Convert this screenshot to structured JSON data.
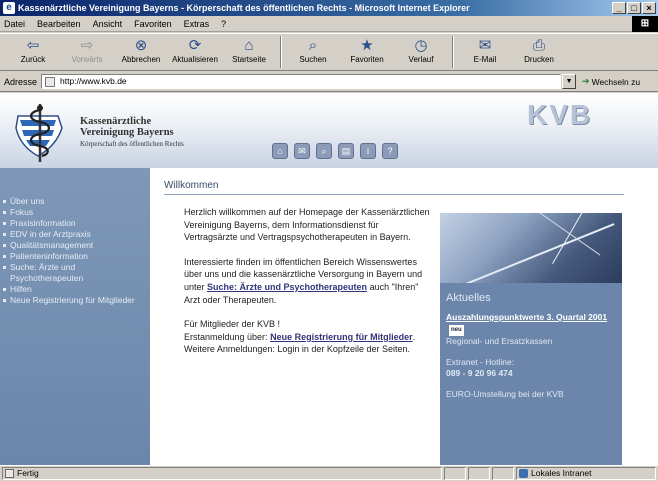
{
  "window": {
    "title": "Kassenärztliche Vereinigung Bayerns - Körperschaft des öffentlichen Rechts - Microsoft Internet Explorer",
    "controls": [
      "_",
      "□",
      "×"
    ]
  },
  "menu": {
    "items": [
      "Datei",
      "Bearbeiten",
      "Ansicht",
      "Favoriten",
      "Extras",
      "?"
    ]
  },
  "toolbar": {
    "buttons": [
      {
        "label": "Zurück",
        "icon": "back-arrow-icon",
        "glyph": "⇦"
      },
      {
        "label": "Vorwärts",
        "icon": "forward-arrow-icon",
        "glyph": "⇨"
      },
      {
        "label": "Abbrechen",
        "icon": "stop-icon",
        "glyph": "⊗"
      },
      {
        "label": "Aktualisieren",
        "icon": "refresh-icon",
        "glyph": "⟳"
      },
      {
        "label": "Startseite",
        "icon": "home-icon",
        "glyph": "⌂"
      },
      {
        "label": "Suchen",
        "icon": "search-icon",
        "glyph": "⌕"
      },
      {
        "label": "Favoriten",
        "icon": "favorites-icon",
        "glyph": "★"
      },
      {
        "label": "Verlauf",
        "icon": "history-icon",
        "glyph": "◷"
      },
      {
        "label": "E-Mail",
        "icon": "mail-icon",
        "glyph": "✉"
      },
      {
        "label": "Drucken",
        "icon": "printer-icon",
        "glyph": "⎙"
      }
    ]
  },
  "address": {
    "label": "Adresse",
    "url": "http://www.kvb.de",
    "go_label": "Wechseln zu"
  },
  "site": {
    "logo_line1": "Kassenärztliche",
    "logo_line2": "Vereinigung Bayerns",
    "logo_line3": "Körperschaft des öffentlichen Rechts",
    "brand_mark": "KVB",
    "header_icons": [
      "home-icon",
      "mail-icon",
      "search-icon",
      "sitemap-icon",
      "info-icon",
      "help-icon"
    ],
    "nav": [
      "Über uns",
      "Fokus",
      "Praxisinformation",
      "EDV in der Arztpraxis",
      "Qualitätsmanagement",
      "Patienteninformation",
      "Suche: Ärzte und Psychotherapeuten",
      "Hilfen",
      "Neue Registrierung für Mitglieder"
    ],
    "welcome_heading": "Willkommen",
    "para1": "Herzlich willkommen auf der Homepage der Kassenärztlichen Vereinigung Bayerns, dem Informationsdienst für Vertragsärzte und Vertragspsychotherapeuten in Bayern.",
    "para2_pre": "Interessierte finden im öffentlichen Bereich Wissenswertes über uns und die kassenärztliche Versorgung in Bayern und unter",
    "para2_link": "Suche: Ärzte und Psychotherapeuten",
    "para2_post": "auch \"Ihren\" Arzt oder Therapeuten.",
    "para3_pre": "Für Mitglieder der KVB !\nErstanmeldung über:",
    "para3_link": "Neue Registrierung für Mitglieder",
    "para3_post": ". Weitere Anmeldungen: Login in der Kopfzeile der Seiten.",
    "news_heading": "Aktuelles",
    "news_item1_link": "Auszahlungspunktwerte 3. Quartal 2001",
    "news_item1_badge": "neu",
    "news_item1_rest": "Regional- und Ersatzkassen",
    "news_item2_line1": "Extranet - Hotline:",
    "news_item2_line2": "089 - 9 20 96 474",
    "news_item3": "EURO-Umstellung bei der KVB"
  },
  "status": {
    "text": "Fertig",
    "zone": "Lokales Intranet"
  }
}
